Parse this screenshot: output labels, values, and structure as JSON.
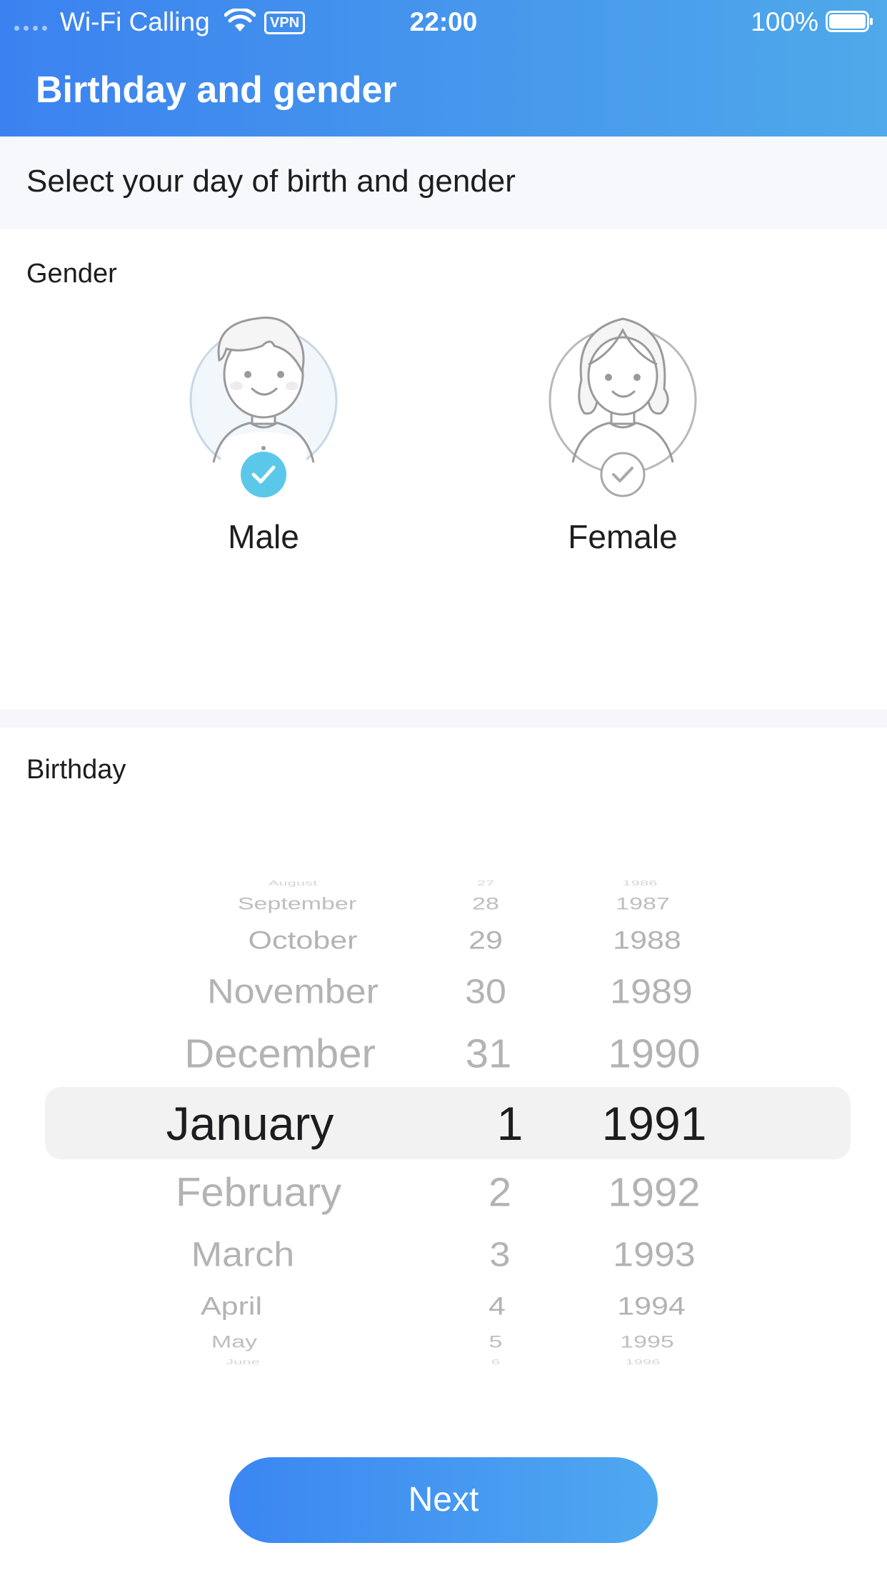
{
  "status_bar": {
    "carrier": "Wi-Fi Calling",
    "vpn": "VPN",
    "time": "22:00",
    "battery": "100%"
  },
  "header": {
    "title": "Birthday and gender"
  },
  "subtitle": "Select your day of birth and gender",
  "gender": {
    "label": "Gender",
    "options": [
      {
        "label": "Male",
        "selected": true
      },
      {
        "label": "Female",
        "selected": false
      }
    ],
    "accent_color": "#5bc8ea"
  },
  "birthday": {
    "label": "Birthday",
    "months": [
      "August",
      "September",
      "October",
      "November",
      "December",
      "January",
      "February",
      "March",
      "April",
      "May",
      "June"
    ],
    "days": [
      "27",
      "28",
      "29",
      "30",
      "31",
      "1",
      "2",
      "3",
      "4",
      "5",
      "6"
    ],
    "years": [
      "1986",
      "1987",
      "1988",
      "1989",
      "1990",
      "1991",
      "1992",
      "1993",
      "1994",
      "1995",
      "1996"
    ],
    "selected": {
      "month": "January",
      "day": "1",
      "year": "1991"
    }
  },
  "next_button": {
    "label": "Next"
  },
  "colors": {
    "brand": "#3b82f0",
    "brand_light": "#4fa9ea"
  }
}
